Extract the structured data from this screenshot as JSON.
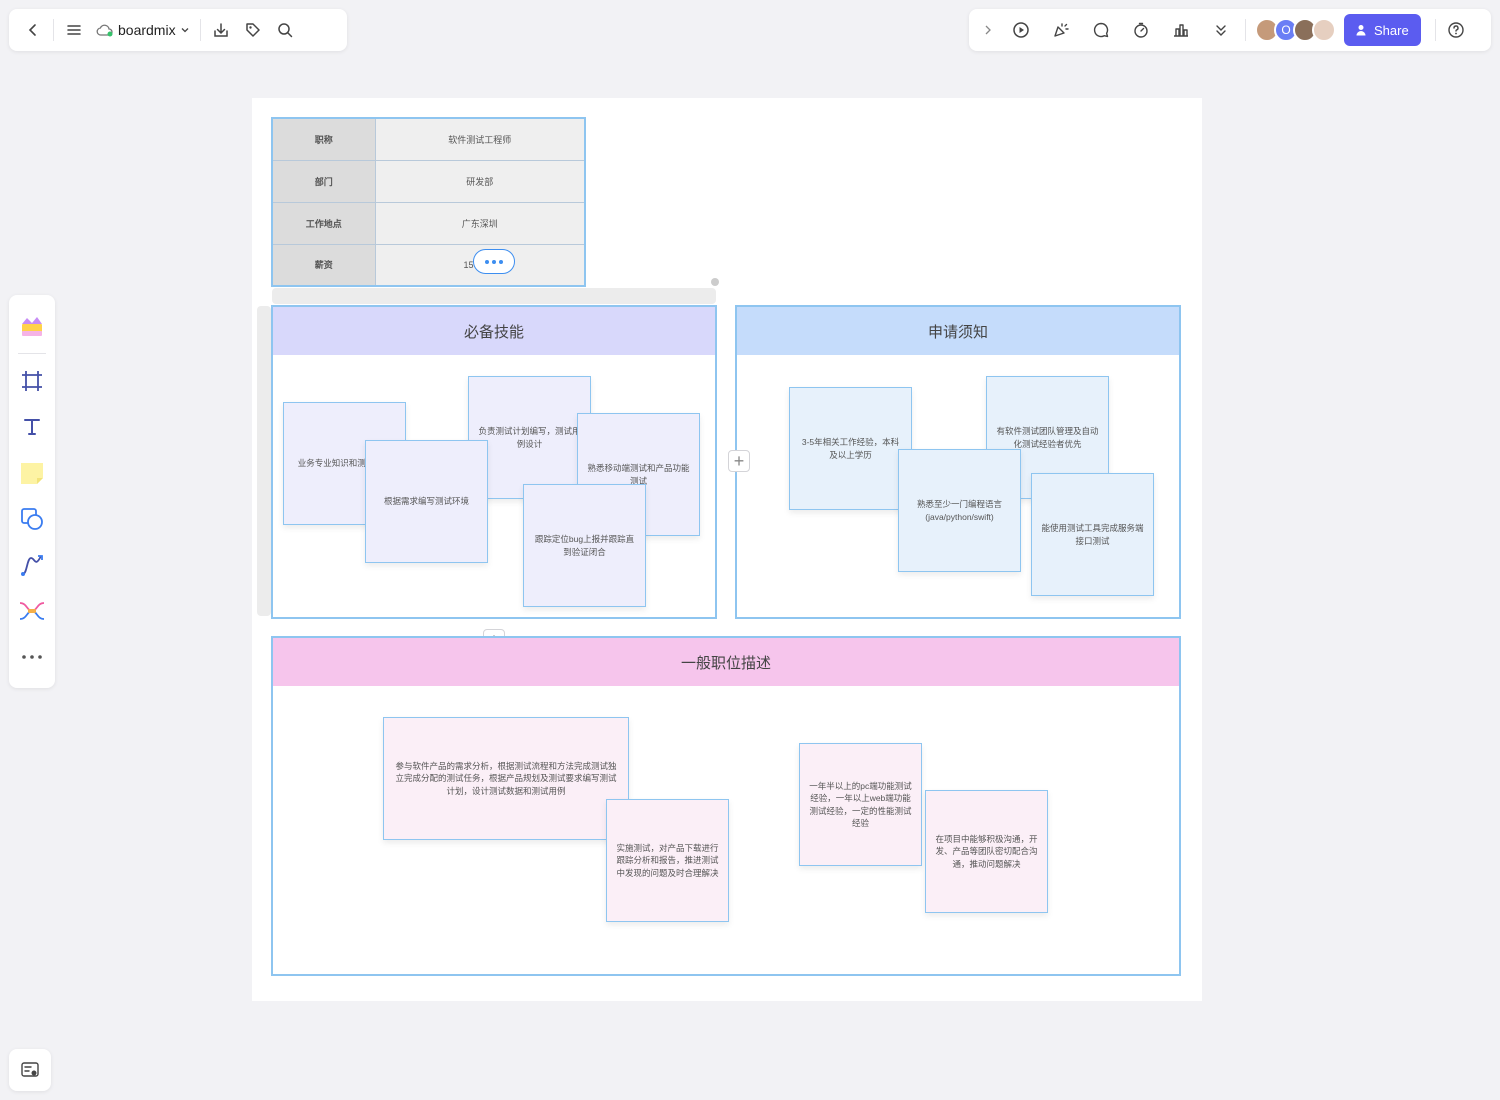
{
  "toolbar": {
    "app_name": "boardmix",
    "share_label": "Share",
    "avatar_letter": "O"
  },
  "colors": {
    "accent": "#5b5cf0",
    "section_border": "#8ec5f0",
    "skills_header": "#d8d8fb",
    "apply_header": "#c5dcfb",
    "desc_header": "#f6c5ec"
  },
  "icons": {
    "back": "chevron-left-icon",
    "menu": "menu-icon",
    "cloud": "cloud-icon",
    "download": "download-icon",
    "tag": "tag-icon",
    "search": "search-icon",
    "expand": "chevron-right-icon",
    "play": "play-icon",
    "celebrate": "party-icon",
    "comment": "comment-icon",
    "timer": "timer-icon",
    "chart": "chart-icon",
    "more": "double-chevron-down-icon",
    "help": "help-icon"
  },
  "info_table": [
    {
      "key": "职称",
      "value": "软件测试工程师"
    },
    {
      "key": "部门",
      "value": "研发部"
    },
    {
      "key": "工作地点",
      "value": "广东深圳"
    },
    {
      "key": "薪资",
      "value": "15"
    }
  ],
  "sections": {
    "skills": {
      "title": "必备技能",
      "notes": [
        "业务专业知识和测试设计",
        "负责测试计划编写，测试用例设计",
        "熟悉移动端测试和产品功能测试",
        "根据需求编写测试环境",
        "跟踪定位bug上报并跟踪直到验证闭合"
      ]
    },
    "apply": {
      "title": "申请须知",
      "notes": [
        "3-5年相关工作经验，本科及以上学历",
        "有软件测试团队管理及自动化测试经验者优先",
        "熟悉至少一门编程语言(java/python/swift)",
        "能使用测试工具完成服务端接口测试"
      ]
    },
    "description": {
      "title": "一般职位描述",
      "notes": [
        "参与软件产品的需求分析，根据测试流程和方法完成测试独立完成分配的测试任务，根据产品规划及测试要求编写测试计划，设计测试数据和测试用例",
        "实施测试，对产品下载进行跟踪分析和报告，推进测试中发现的问题及时合理解决",
        "一年半以上的pc端功能测试经验，一年以上web端功能测试经验，一定的性能测试经验",
        "在项目中能够积极沟通，开发、产品等团队密切配合沟通，推动问题解决"
      ]
    }
  }
}
